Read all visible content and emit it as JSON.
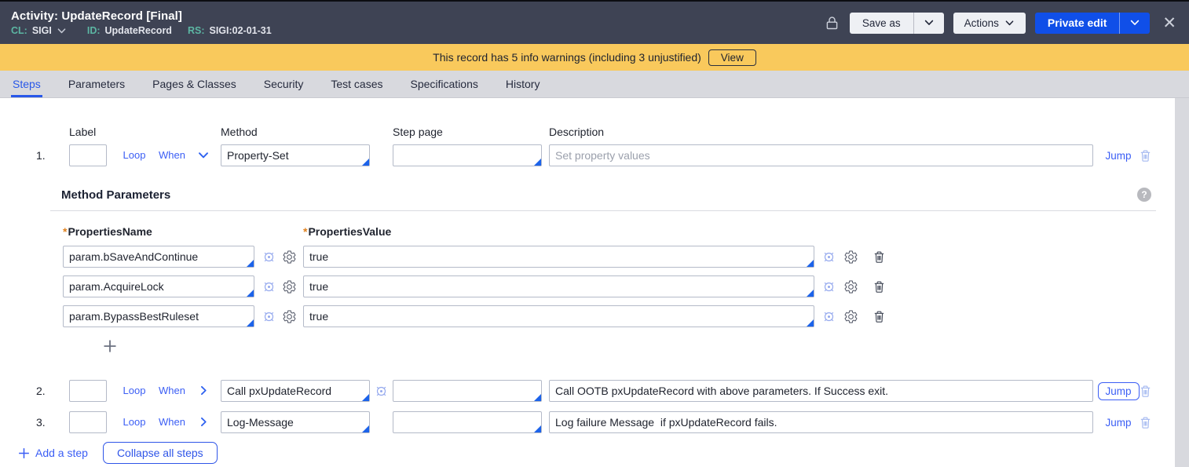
{
  "colors": {
    "header_bg": "#3e4354",
    "accent_blue": "#104fe8",
    "link_blue": "#3b5ef5",
    "warning_yellow": "#f9c95c",
    "meta_teal": "#5cb6a3",
    "required_orange": "#e0821f"
  },
  "icons": {
    "lock": "padlock-outline",
    "close": "x-glyph",
    "chevron_down": "v-chevron",
    "chevron_right": "right-chevron",
    "goal_seek": "crosshair-target",
    "gear": "cog-outline",
    "trash": "trash-can",
    "plus": "plus-cross",
    "help": "question-mark-circle"
  },
  "header": {
    "title": "Activity: UpdateRecord [Final]",
    "meta": [
      {
        "label": "CL:",
        "value": "SIGI"
      },
      {
        "label": "ID:",
        "value": "UpdateRecord"
      },
      {
        "label": "RS:",
        "value": "SIGI:02-01-31"
      }
    ],
    "save_as_label": "Save as",
    "actions_label": "Actions",
    "private_edit_label": "Private edit",
    "close_glyph": "✕"
  },
  "warning_bar": {
    "text": "This record has 5 info warnings (including 3 unjustified)",
    "view_label": "View"
  },
  "tabs": [
    {
      "label": "Steps",
      "active": true
    },
    {
      "label": "Parameters",
      "active": false
    },
    {
      "label": "Pages & Classes",
      "active": false
    },
    {
      "label": "Security",
      "active": false
    },
    {
      "label": "Test cases",
      "active": false
    },
    {
      "label": "Specifications",
      "active": false
    },
    {
      "label": "History",
      "active": false
    }
  ],
  "steps_form": {
    "column_headers": {
      "label": "Label",
      "method": "Method",
      "step_page": "Step page",
      "description": "Description"
    },
    "loop_label": "Loop",
    "when_label": "When",
    "jump_label": "Jump",
    "steps": [
      {
        "number": "1.",
        "label": "",
        "method": "Property-Set",
        "step_page": "",
        "description": "",
        "description_placeholder": "Set property values"
      },
      {
        "number": "2.",
        "label": "",
        "method": "Call pxUpdateRecord",
        "step_page": "",
        "description": "Call OOTB pxUpdateRecord with above parameters. If Success exit."
      },
      {
        "number": "3.",
        "label": "",
        "method": "Log-Message",
        "step_page": "",
        "description": "Log failure Message  if pxUpdateRecord fails."
      }
    ],
    "method_parameters": {
      "title": "Method Parameters",
      "required_marker": "*",
      "name_header": "PropertiesName",
      "value_header": "PropertiesValue",
      "rows": [
        {
          "name": "param.bSaveAndContinue",
          "value": "true"
        },
        {
          "name": "param.AcquireLock",
          "value": "true"
        },
        {
          "name": "param.BypassBestRuleset",
          "value": "true"
        }
      ]
    },
    "add_step_label": "Add a step",
    "collapse_all_label": "Collapse all steps"
  }
}
